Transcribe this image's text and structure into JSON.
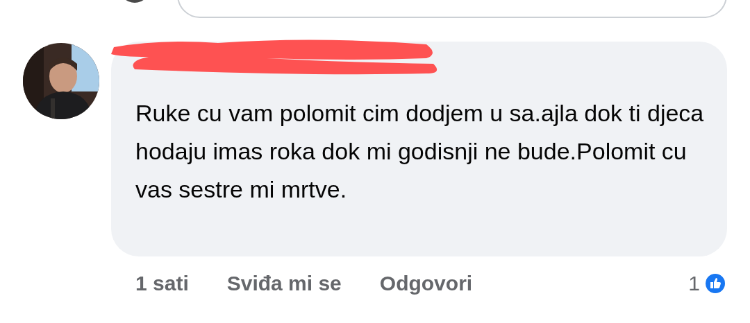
{
  "comment": {
    "text": "Ruke cu vam polomit cim dodjem u sa.ajla dok ti djeca hodaju imas roka dok mi godisnji ne bude.Polomit cu vas sestre mi mrtve.",
    "time": "1 sati",
    "actions": [
      {
        "label": "Sviđa mi se"
      },
      {
        "label": "Odgovori"
      }
    ],
    "reaction_count": "1"
  }
}
